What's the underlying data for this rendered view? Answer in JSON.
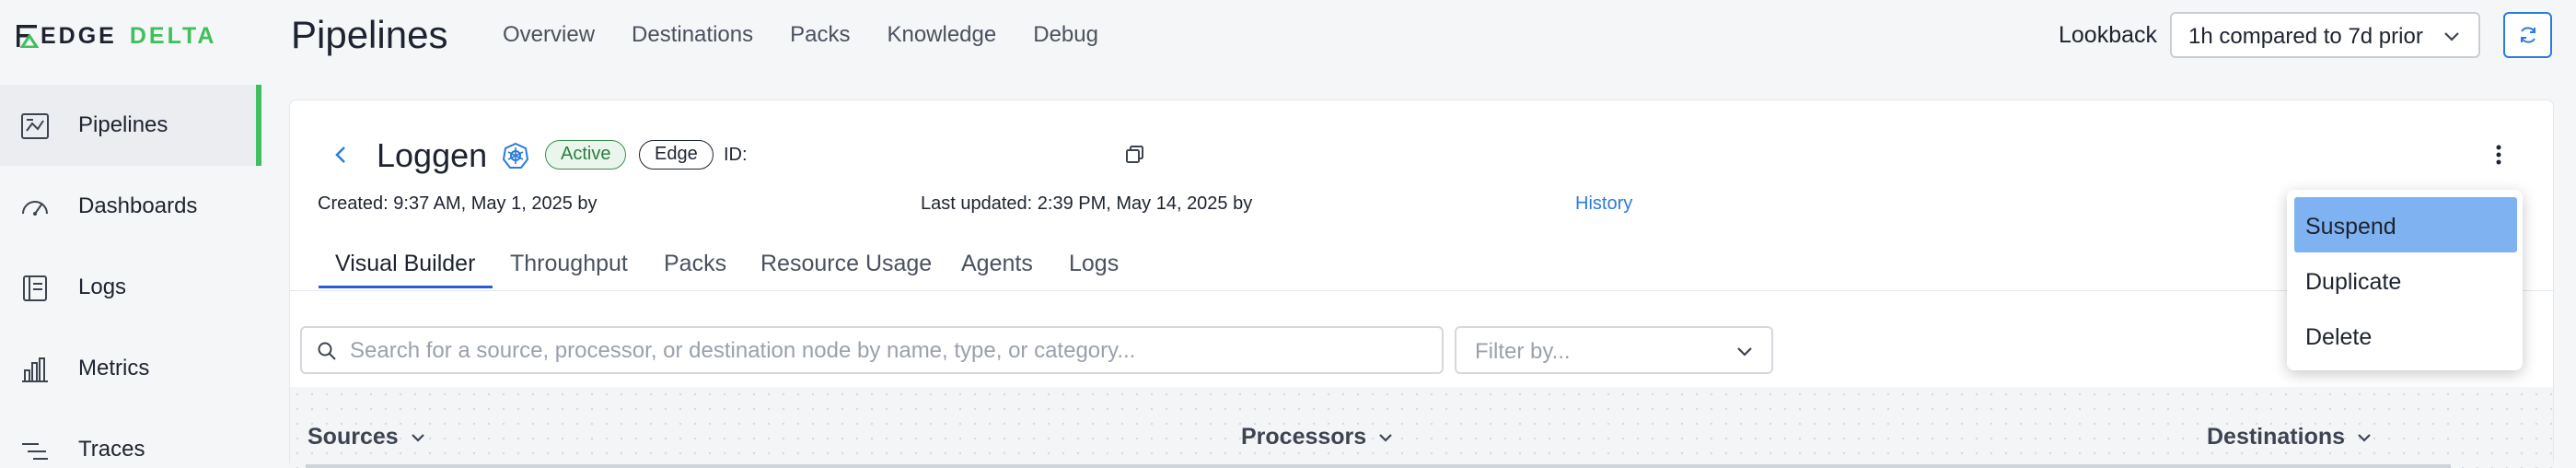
{
  "brand": {
    "logo_left": "EDGE",
    "logo_right": "DELTA"
  },
  "header": {
    "title": "Pipelines",
    "nav": [
      "Overview",
      "Destinations",
      "Packs",
      "Knowledge",
      "Debug"
    ],
    "lookback_label": "Lookback",
    "lookback_value": "1h compared to 7d prior"
  },
  "sidebar": {
    "items": [
      {
        "label": "Pipelines",
        "icon": "pipelines-icon",
        "active": true
      },
      {
        "label": "Dashboards",
        "icon": "dashboard-gauge-icon"
      },
      {
        "label": "Logs",
        "icon": "logs-icon"
      },
      {
        "label": "Metrics",
        "icon": "bar-chart-icon"
      },
      {
        "label": "Traces",
        "icon": "traces-icon"
      }
    ]
  },
  "pipeline": {
    "name": "Loggen",
    "status": "Active",
    "type": "Edge",
    "id_label": "ID:",
    "created": "Created: 9:37 AM, May 1, 2025 by",
    "updated": "Last updated: 2:39 PM, May 14, 2025 by",
    "history": "History"
  },
  "tabs": [
    "Visual Builder",
    "Throughput",
    "Packs",
    "Resource Usage",
    "Agents",
    "Logs"
  ],
  "search": {
    "placeholder": "Search for a source, processor, or destination node by name, type, or category..."
  },
  "filter": {
    "placeholder": "Filter by..."
  },
  "columns": [
    "Sources",
    "Processors",
    "Destinations"
  ],
  "menu": {
    "items": [
      "Suspend",
      "Duplicate",
      "Delete"
    ],
    "highlighted": "Suspend"
  },
  "colors": {
    "brand_green": "#3fbf5d",
    "accent_blue": "#2a7bde",
    "menu_highlight": "#7fb2f0"
  }
}
